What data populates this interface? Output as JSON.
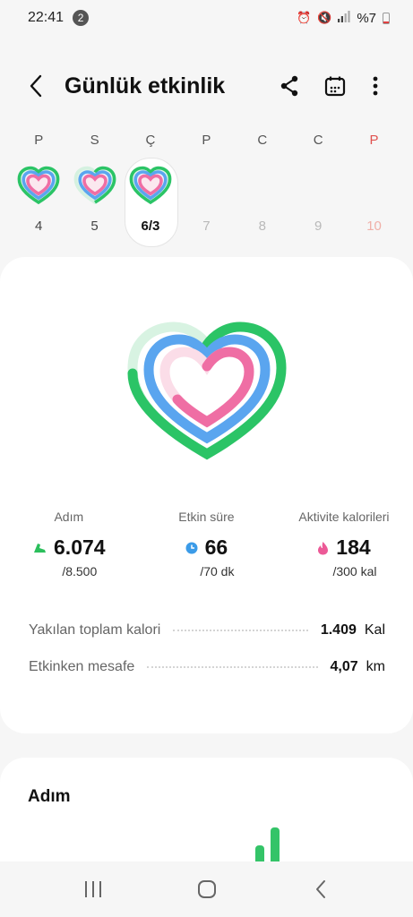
{
  "status": {
    "time": "22:41",
    "notif_count": "2",
    "battery": "%7"
  },
  "header": {
    "title": "Günlük etkinlik"
  },
  "week": {
    "days": [
      {
        "label": "P",
        "num": "4",
        "has_ring": true
      },
      {
        "label": "S",
        "num": "5",
        "has_ring": true
      },
      {
        "label": "Ç",
        "num": "6/3",
        "has_ring": true,
        "selected": true
      },
      {
        "label": "P",
        "num": "7",
        "has_ring": false
      },
      {
        "label": "C",
        "num": "8",
        "has_ring": false
      },
      {
        "label": "C",
        "num": "9",
        "has_ring": false
      },
      {
        "label": "P",
        "num": "10",
        "has_ring": false,
        "weekend": true
      }
    ]
  },
  "stats": {
    "steps": {
      "label": "Adım",
      "value": "6.074",
      "goal": "/8.500",
      "icon": "shoe-icon",
      "color": "#2bbf5c"
    },
    "active_time": {
      "label": "Etkin süre",
      "value": "66",
      "goal": "/70 dk",
      "icon": "clock-icon",
      "color": "#3b9be8"
    },
    "calories": {
      "label": "Aktivite kalorileri",
      "value": "184",
      "goal": "/300 kal",
      "icon": "flame-icon",
      "color": "#ec5a97"
    }
  },
  "details": {
    "total_calories": {
      "label": "Yakılan toplam kalori",
      "value": "1.409",
      "unit": "Kal"
    },
    "distance": {
      "label": "Etkinken mesafe",
      "value": "4,07",
      "unit": "km"
    }
  },
  "steps_card": {
    "title": "Adım"
  },
  "colors": {
    "green": "#2bc466",
    "blue": "#5aa5ef",
    "pink": "#ef6ea4"
  }
}
